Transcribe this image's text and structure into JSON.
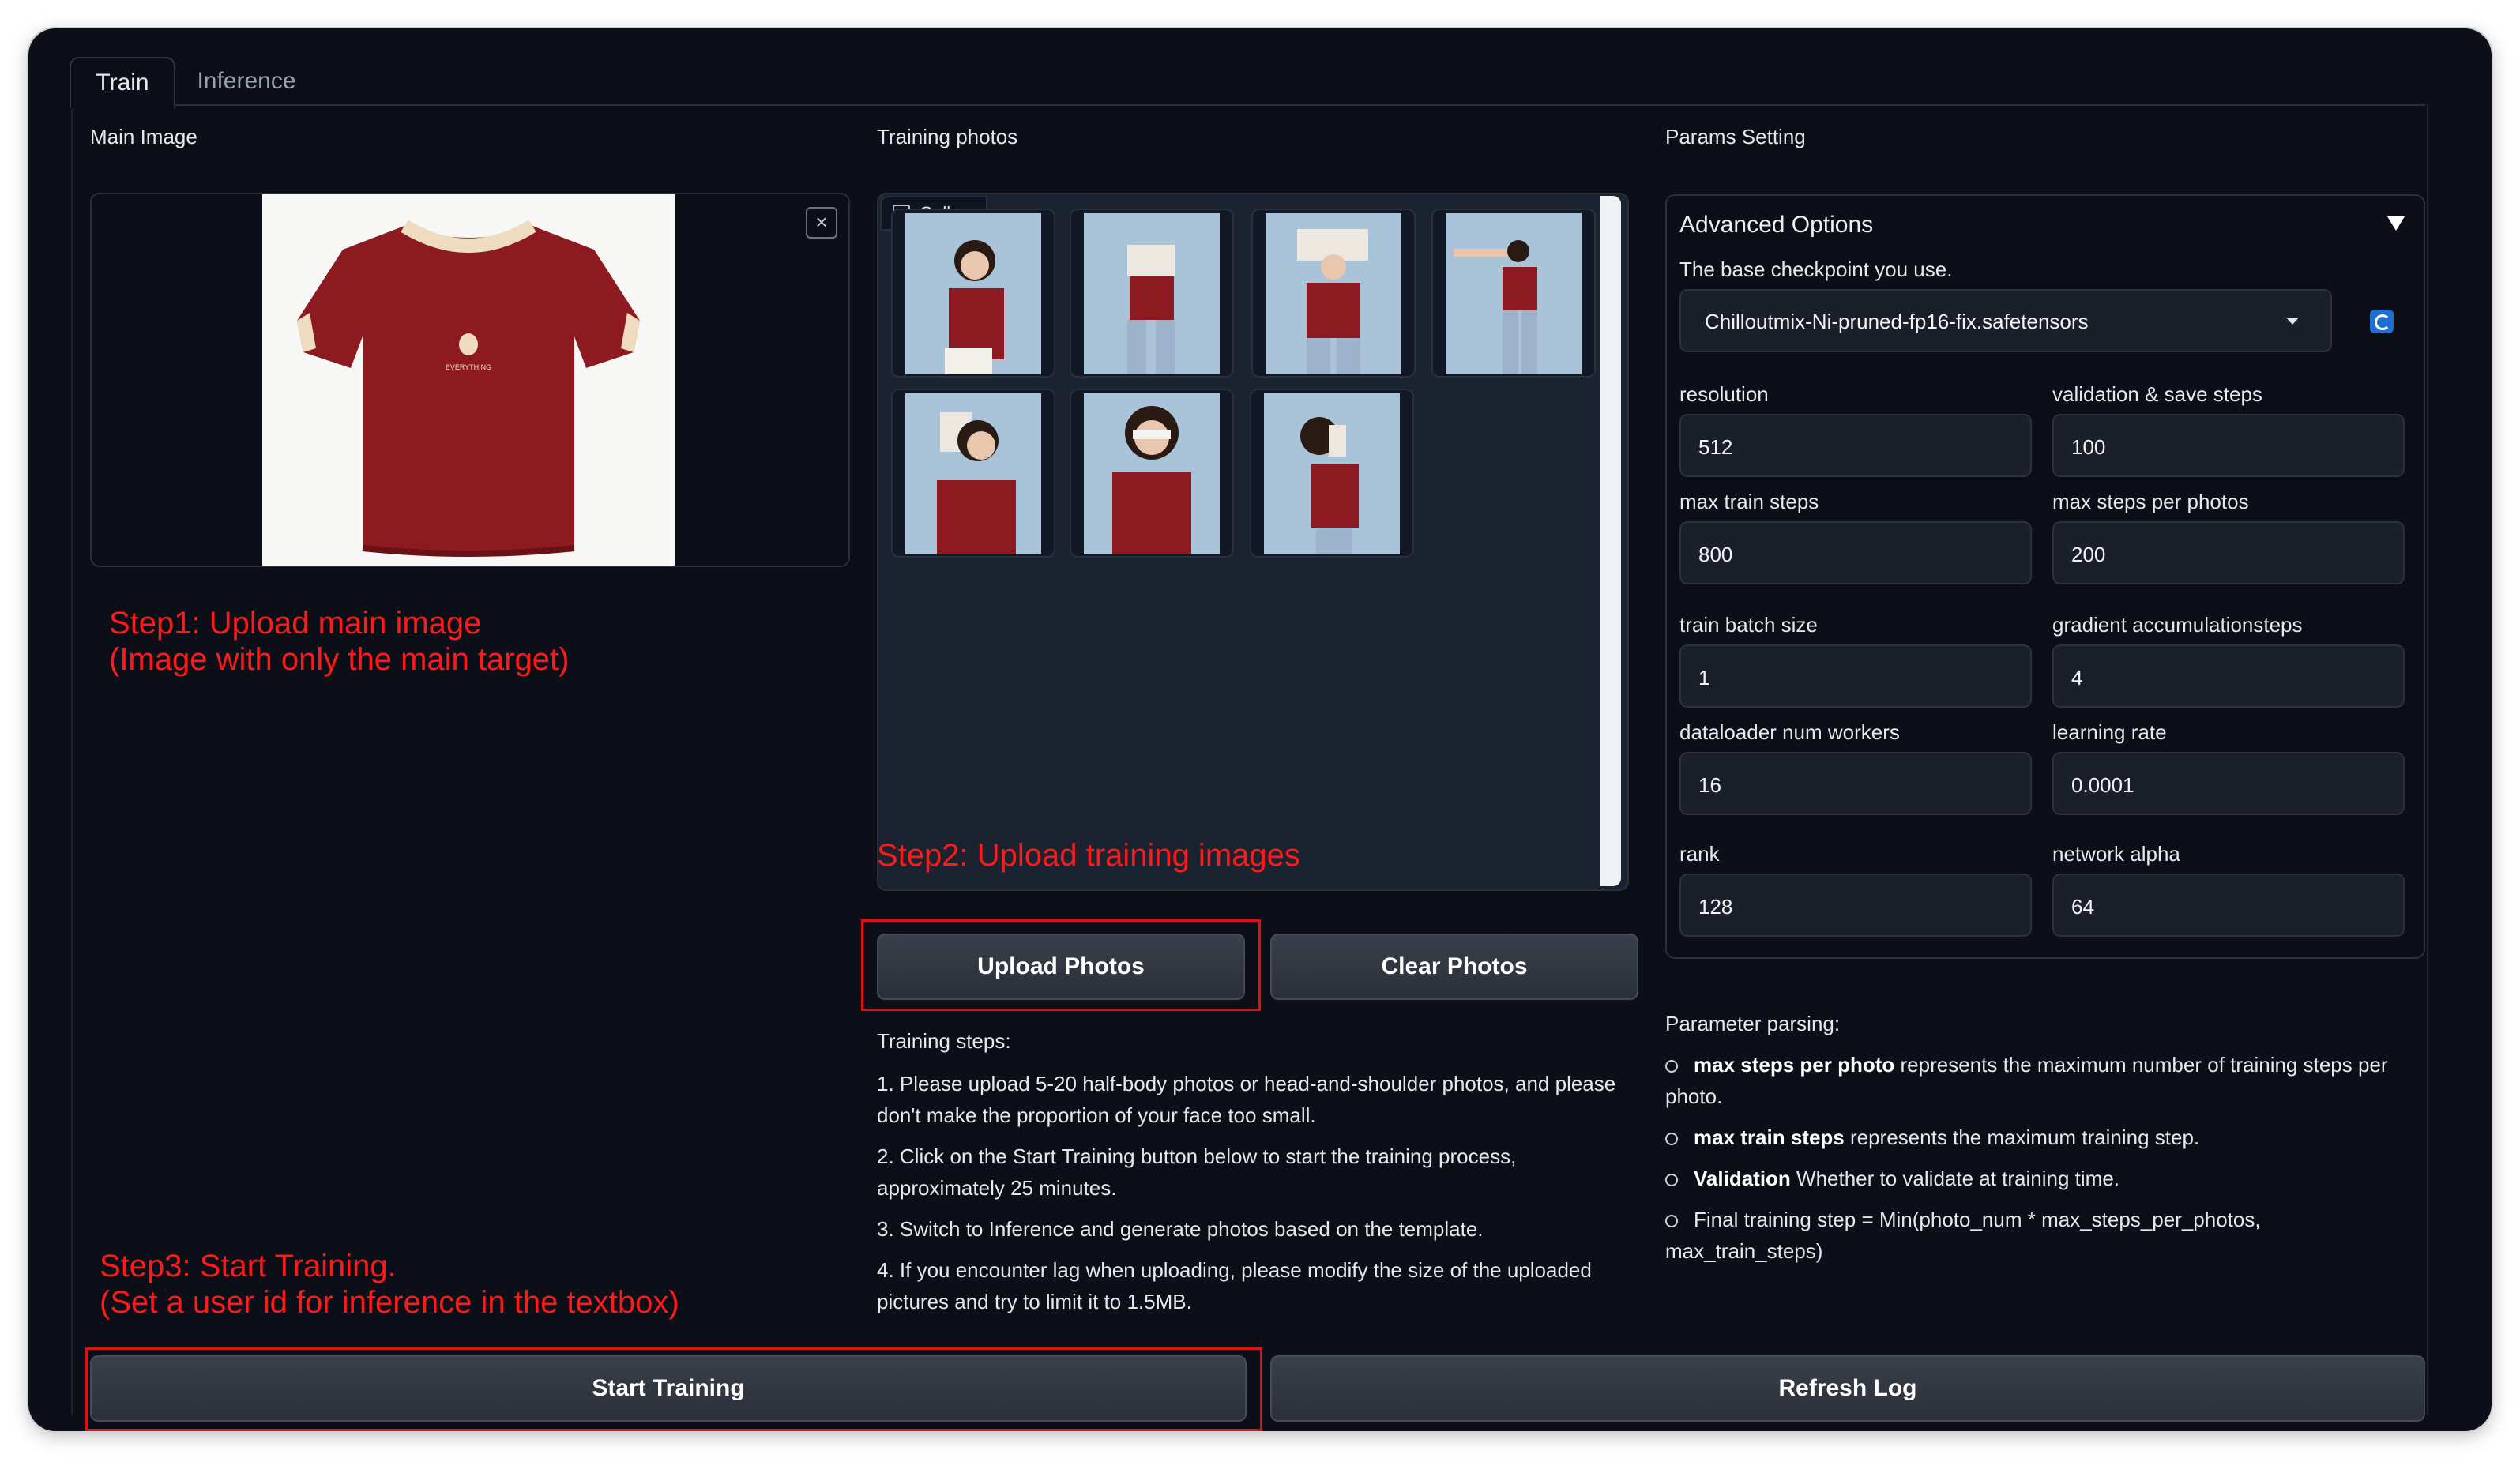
{
  "tabs": {
    "train": "Train",
    "inference": "Inference"
  },
  "left": {
    "label": "Main Image",
    "close": "×",
    "shirt_text": "EVERYTHING",
    "step1_line1": "Step1: Upload main image",
    "step1_line2": "(Image with only the main target)",
    "step3_line1": "Step3: Start Training.",
    "step3_line2": "(Set a user id for inference in the textbox)"
  },
  "middle": {
    "label": "Training photos",
    "gallery_badge": "Gallery",
    "step2": "Step2: Upload training images",
    "upload_button": "Upload Photos",
    "clear_button": "Clear Photos",
    "steps_title": "Training steps:",
    "steps": [
      "1. Please upload 5-20 half-body photos or head-and-shoulder photos, and please",
      "don't make the proportion of your face too small.",
      "2. Click on the Start Training button below to start the training process,",
      "approximately 25 minutes.",
      "3. Switch to Inference and generate photos based on the template.",
      "4. If you encounter lag when uploading, please modify the size of the uploaded",
      "pictures and try to limit it to 1.5MB."
    ]
  },
  "right": {
    "label": "Params Setting",
    "advanced": "Advanced Options",
    "checkpoint_label": "The base checkpoint you use.",
    "checkpoint_value": "Chilloutmix-Ni-pruned-fp16-fix.safetensors",
    "resolution_label": "resolution",
    "resolution": "512",
    "val_label": "validation & save steps",
    "val": "100",
    "max_train_label": "max train steps",
    "max_train": "800",
    "max_per_label": "max steps per photos",
    "max_per": "200",
    "batch_label": "train batch size",
    "batch": "1",
    "grad_label": "gradient accumulationsteps",
    "grad": "4",
    "workers_label": "dataloader num workers",
    "workers": "16",
    "lr_label": "learning rate",
    "lr": "0.0001",
    "rank_label": "rank",
    "rank": "128",
    "alpha_label": "network alpha",
    "alpha": "64",
    "parsing_title": "Parameter parsing:",
    "p1_bold": "max steps per photo",
    "p1_rest": " represents the maximum number of training steps per",
    "p1_line2": "photo.",
    "p2_bold": "max train steps",
    "p2_rest": " represents the maximum training step.",
    "p3_bold": "Validation",
    "p3_rest": " Whether to validate at training time.",
    "p4_line1": "Final training step = Min(photo_num * max_steps_per_photos,",
    "p4_line2": "max_train_steps)"
  },
  "bottom": {
    "start": "Start Training",
    "refresh": "Refresh Log"
  },
  "colors": {
    "annotation": "#ff1a1a",
    "shirt": "#8c1a20",
    "trim": "#efdcc0",
    "background": "#0c0f17"
  }
}
